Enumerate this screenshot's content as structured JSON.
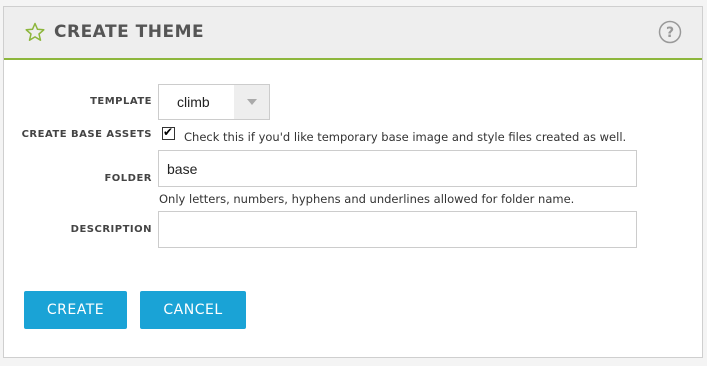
{
  "header": {
    "title": "CREATE THEME",
    "icon": "star-outline-icon",
    "help_icon": "question-circle-icon",
    "accent_color": "#8db63c"
  },
  "form": {
    "template": {
      "label": "TEMPLATE",
      "value": "climb"
    },
    "create_base_assets": {
      "label": "CREATE BASE ASSETS",
      "checked": true,
      "help": "Check this if you'd like temporary base image and style files created as well."
    },
    "folder": {
      "label": "FOLDER",
      "value": "base",
      "help": "Only letters, numbers, hyphens and underlines allowed for folder name."
    },
    "description": {
      "label": "DESCRIPTION",
      "value": ""
    }
  },
  "actions": {
    "create_label": "CREATE",
    "cancel_label": "CANCEL",
    "button_color": "#1aa3d6"
  }
}
